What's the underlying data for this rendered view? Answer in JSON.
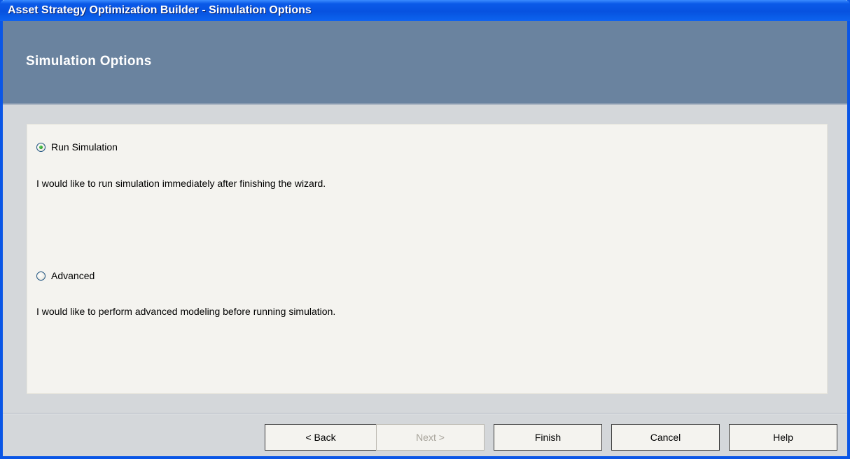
{
  "window": {
    "title": "Asset Strategy Optimization Builder - Simulation Options"
  },
  "header": {
    "title": "Simulation Options"
  },
  "options": [
    {
      "label": "Run Simulation",
      "description": "I would like to run simulation immediately after finishing the wizard.",
      "selected": true
    },
    {
      "label": "Advanced",
      "description": "I would like to perform advanced modeling before running simulation.",
      "selected": false
    }
  ],
  "buttons": {
    "back": "< Back",
    "next": "Next >",
    "finish": "Finish",
    "cancel": "Cancel",
    "help": "Help"
  },
  "colors": {
    "titlebar": "#0752e0",
    "header_band": "#6a839f",
    "panel_background": "#f4f3ef",
    "dialog_background": "#d4d7da"
  }
}
